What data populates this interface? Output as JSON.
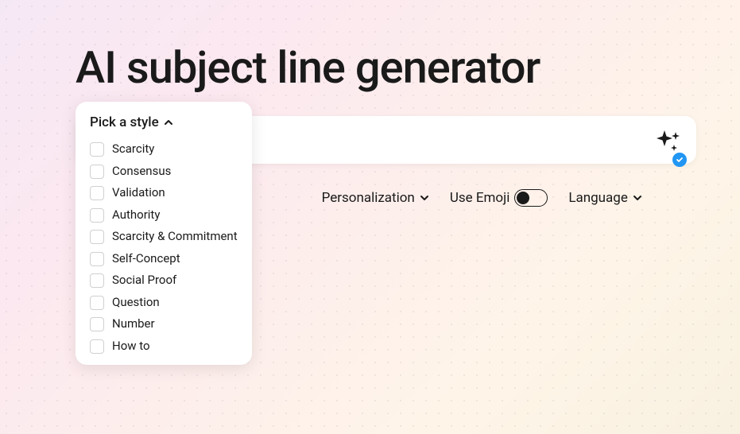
{
  "title": "AI subject line generator",
  "input": {
    "value": "",
    "placeholder": ""
  },
  "options": {
    "personalization": {
      "label": "Personalization"
    },
    "emoji": {
      "label": "Use Emoji",
      "enabled": false
    },
    "language": {
      "label": "Language"
    }
  },
  "styleDropdown": {
    "header": "Pick a style",
    "items": [
      {
        "label": "Scarcity",
        "checked": false
      },
      {
        "label": "Consensus",
        "checked": false
      },
      {
        "label": "Validation",
        "checked": false
      },
      {
        "label": "Authority",
        "checked": false
      },
      {
        "label": "Scarcity & Commitment",
        "checked": false
      },
      {
        "label": "Self-Concept",
        "checked": false
      },
      {
        "label": "Social Proof",
        "checked": false
      },
      {
        "label": "Question",
        "checked": false
      },
      {
        "label": "Number",
        "checked": false
      },
      {
        "label": "How to",
        "checked": false
      }
    ]
  }
}
